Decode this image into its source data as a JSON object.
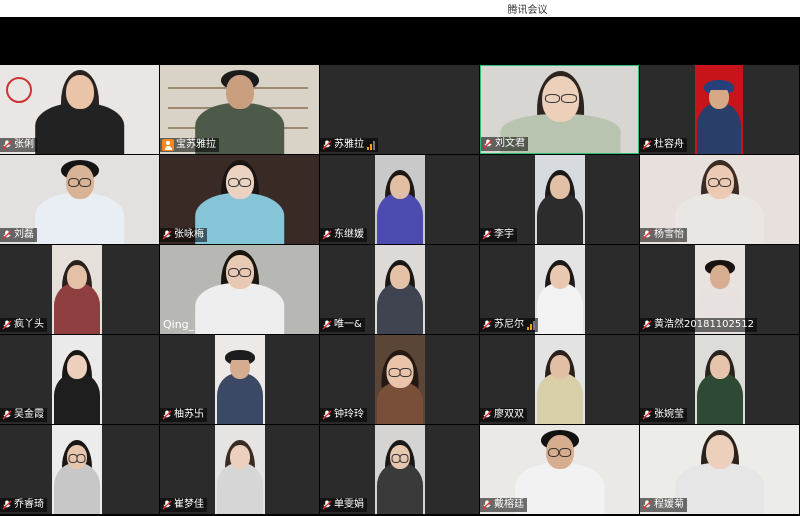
{
  "app": {
    "title": "腾讯会议"
  },
  "colors": {
    "active_speaker_border": "#2fbf71",
    "nameplate_bg": "rgba(0,0,0,0.55)",
    "signal": "#f0a020",
    "host_icon": "#f08a24"
  },
  "participants": [
    {
      "name": "张俐"
    },
    {
      "name": "宝苏雅拉",
      "icon": "user-icon"
    },
    {
      "name": "苏雅拉",
      "signal": true
    },
    {
      "name": "刘文君",
      "active": true
    },
    {
      "name": "杜容舟"
    },
    {
      "name": "刘磊"
    },
    {
      "name": "张咏梅"
    },
    {
      "name": "东继媛"
    },
    {
      "name": "李宇"
    },
    {
      "name": "杨雪怡"
    },
    {
      "name": "疯丫头"
    },
    {
      "name": "Qing_"
    },
    {
      "name": "唯一&"
    },
    {
      "name": "苏尼尔",
      "signal": true
    },
    {
      "name": "黄浩然20181102512"
    },
    {
      "name": "吴金霞"
    },
    {
      "name": "柚苏卐"
    },
    {
      "name": "钟玲玲"
    },
    {
      "name": "廖双双"
    },
    {
      "name": "张婉莹"
    },
    {
      "name": "乔睿琦"
    },
    {
      "name": "崔梦佳"
    },
    {
      "name": "单雯娟"
    },
    {
      "name": "戴榕廷"
    },
    {
      "name": "程媛菊"
    }
  ]
}
